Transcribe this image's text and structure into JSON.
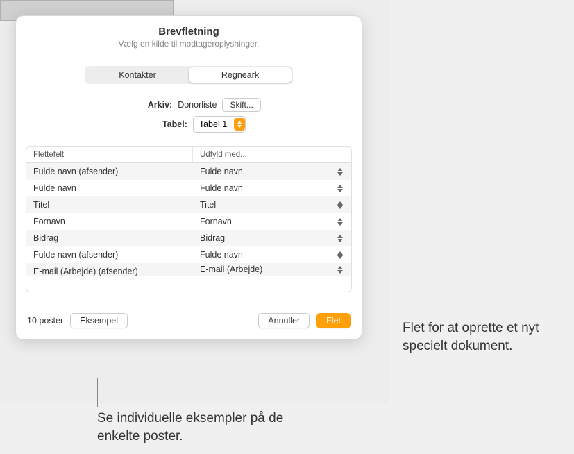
{
  "dialog": {
    "title": "Brevfletning",
    "subtitle": "Vælg en kilde til modtageroplysninger."
  },
  "tabs": {
    "contacts": "Kontakter",
    "spreadsheet": "Regneark"
  },
  "source": {
    "archive_label": "Arkiv:",
    "archive_value": "Donorliste",
    "change_button": "Skift...",
    "table_label": "Tabel:",
    "table_value": "Tabel 1"
  },
  "table": {
    "header_left": "Flettefelt",
    "header_right": "Udfyld med...",
    "rows": [
      {
        "field": "Fulde navn (afsender)",
        "fill": "Fulde navn"
      },
      {
        "field": "Fulde navn",
        "fill": "Fulde navn"
      },
      {
        "field": "Titel",
        "fill": "Titel"
      },
      {
        "field": "Fornavn",
        "fill": "Fornavn"
      },
      {
        "field": "Bidrag",
        "fill": "Bidrag"
      },
      {
        "field": "Fulde navn (afsender)",
        "fill": "Fulde navn"
      },
      {
        "field": "E-mail (Arbejde) (afsender)",
        "fill": "E-mail (Arbejde)"
      }
    ]
  },
  "footer": {
    "count": "10 poster",
    "preview": "Eksempel",
    "cancel": "Annuller",
    "merge": "Flet"
  },
  "callouts": {
    "merge": "Flet for at oprette et nyt specielt dokument.",
    "preview": "Se individuelle eksempler på de enkelte poster."
  }
}
